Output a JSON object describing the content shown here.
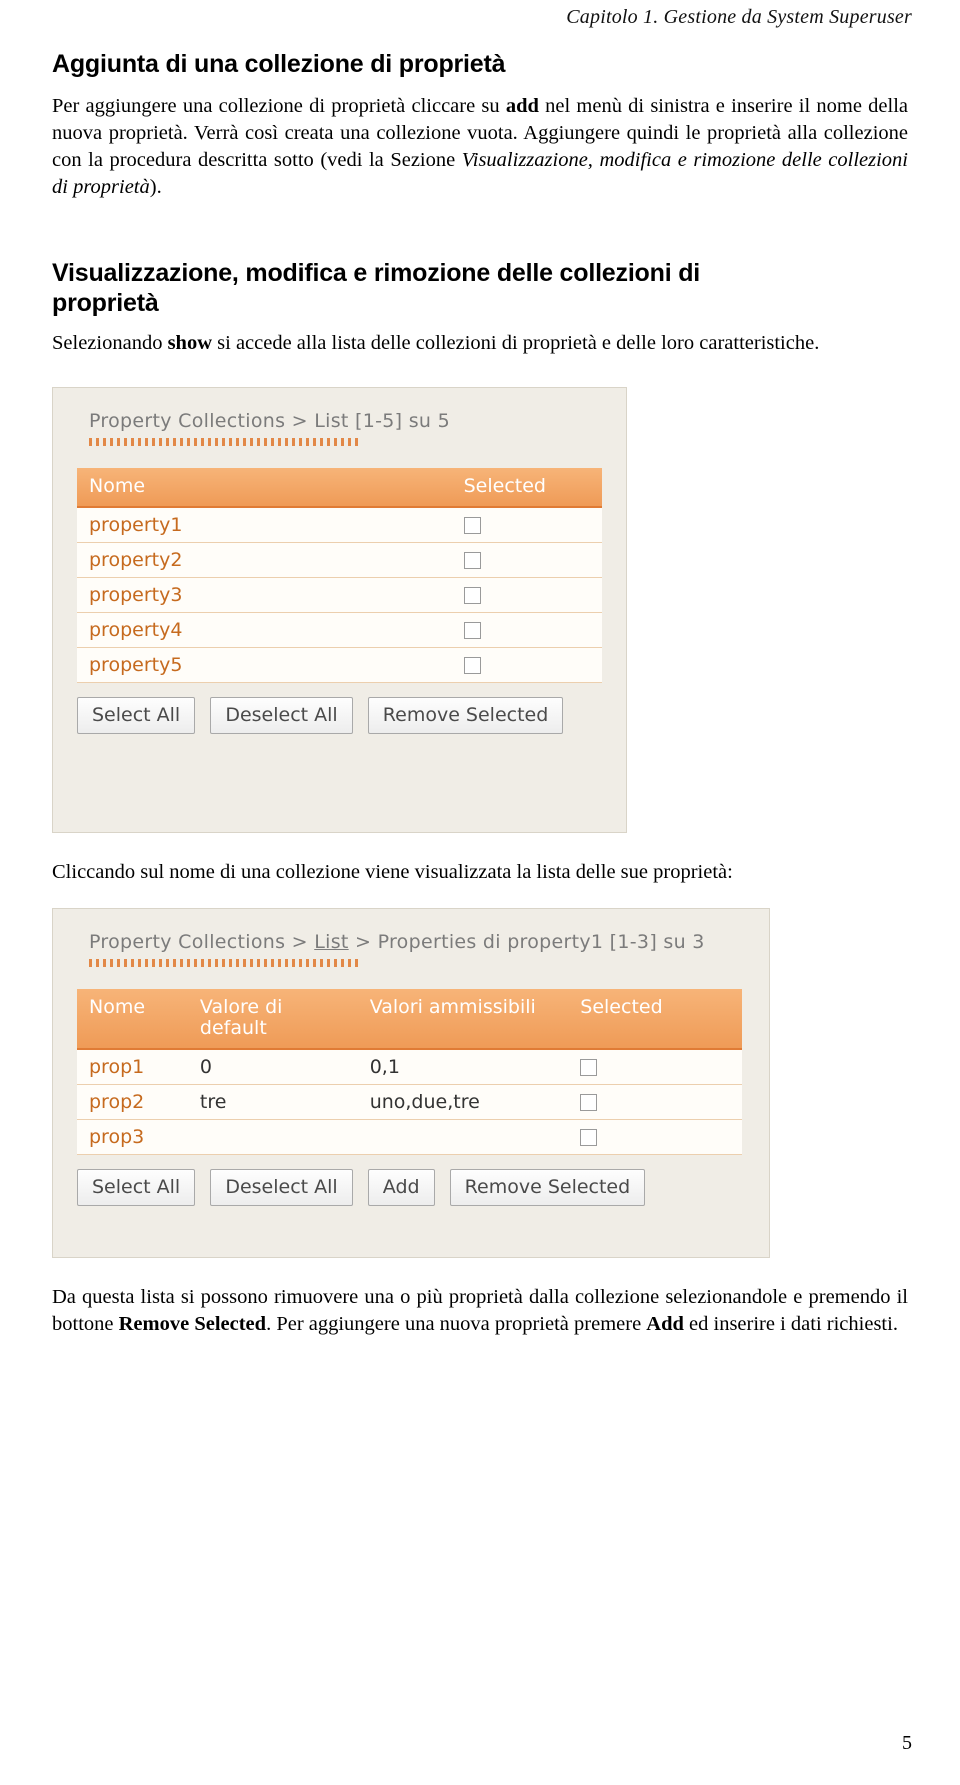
{
  "header": {
    "running_head": "Capitolo 1. Gestione da System Superuser"
  },
  "page": {
    "number": "5"
  },
  "sections": [
    {
      "title": "Aggiunta di una collezione di proprietà",
      "paragraph_parts": [
        {
          "text": "Per aggiungere una collezione di proprietà cliccare su ",
          "style": "normal"
        },
        {
          "text": "add",
          "style": "bold"
        },
        {
          "text": " nel menù di sinistra e inserire il nome della nuova proprietà. Verrà così creata una collezione vuota. Aggiungere quindi le proprietà alla collezione con la procedura descritta sotto (vedi la Sezione ",
          "style": "normal"
        },
        {
          "text": "Visualizzazione, modifica e rimozione delle collezioni di proprietà",
          "style": "italic"
        },
        {
          "text": ").",
          "style": "normal"
        }
      ]
    },
    {
      "title": "Visualizzazione, modifica e rimozione delle collezioni di proprietà",
      "paragraph_parts": [
        {
          "text": "Selezionando ",
          "style": "normal"
        },
        {
          "text": "show",
          "style": "bold"
        },
        {
          "text": " si accede alla lista delle collezioni di proprietà e delle loro caratteristiche.",
          "style": "normal"
        }
      ]
    }
  ],
  "screenshot1": {
    "breadcrumb": {
      "prefix": "Property Collections",
      "sep1": " > ",
      "link1": "List",
      "suffix": " [1-5] su 5"
    },
    "columns": [
      "Nome",
      "Selected"
    ],
    "rows": [
      {
        "name": "property1",
        "selected": false
      },
      {
        "name": "property2",
        "selected": false
      },
      {
        "name": "property3",
        "selected": false
      },
      {
        "name": "property4",
        "selected": false
      },
      {
        "name": "property5",
        "selected": false
      }
    ],
    "buttons": [
      "Select All",
      "Deselect All",
      "Remove Selected"
    ]
  },
  "middle_caption": "Cliccando sul nome di una collezione viene visualizzata la lista delle sue proprietà:",
  "screenshot2": {
    "breadcrumb": {
      "prefix": "Property Collections",
      "sep1": " > ",
      "link1": "List",
      "sep2": " > ",
      "mid": "Properties di property1",
      "suffix": " [1-3] su 3"
    },
    "columns": [
      "Nome",
      "Valore di default",
      "Valori ammissibili",
      "Selected"
    ],
    "rows": [
      {
        "name": "prop1",
        "default": "0",
        "allowed": "0,1",
        "selected": false
      },
      {
        "name": "prop2",
        "default": "tre",
        "allowed": "uno,due,tre",
        "selected": false
      },
      {
        "name": "prop3",
        "default": "",
        "allowed": "",
        "selected": false
      }
    ],
    "buttons": [
      "Select All",
      "Deselect All",
      "Add",
      "Remove Selected"
    ]
  },
  "footer_paragraph_parts": [
    {
      "text": "Da questa lista si possono rimuovere una o più proprietà dalla collezione selezionandole e premendo il bottone ",
      "style": "normal"
    },
    {
      "text": "Remove Selected",
      "style": "bold"
    },
    {
      "text": ". Per aggiungere una nuova proprietà premere ",
      "style": "normal"
    },
    {
      "text": "Add",
      "style": "bold"
    },
    {
      "text": " ed inserire i dati richiesti.",
      "style": "normal"
    }
  ]
}
